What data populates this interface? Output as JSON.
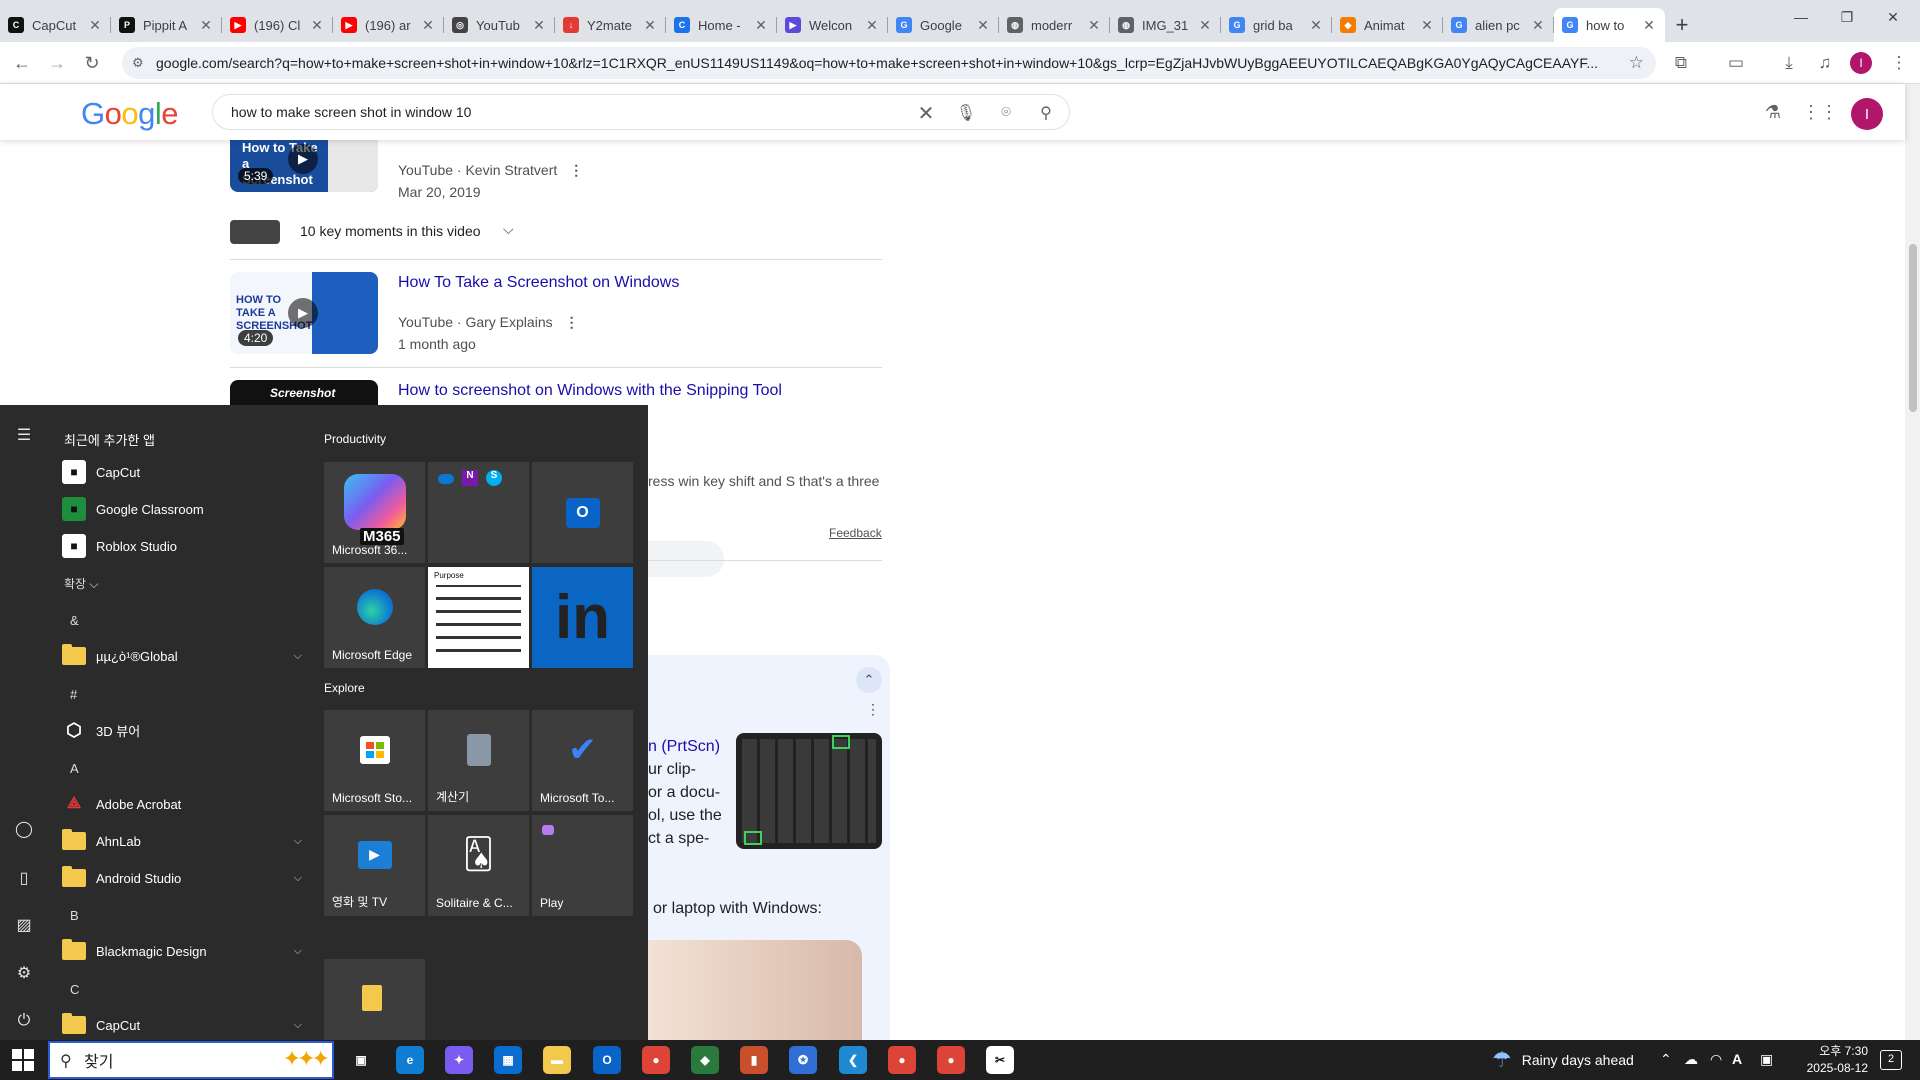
{
  "browser": {
    "tabs": [
      {
        "label": "CapCut",
        "color": "#111111",
        "glyph": "C"
      },
      {
        "label": "Pippit A",
        "color": "#111111",
        "glyph": "P"
      },
      {
        "label": "(196) Cl",
        "color": "#ff0000",
        "glyph": "▶"
      },
      {
        "label": "(196) ar",
        "color": "#ff0000",
        "glyph": "▶"
      },
      {
        "label": "YouTub",
        "color": "#444444",
        "glyph": "◎"
      },
      {
        "label": "Y2mate",
        "color": "#e53935",
        "glyph": "↓"
      },
      {
        "label": "Home -",
        "color": "#1a73e8",
        "glyph": "C"
      },
      {
        "label": "Welcon",
        "color": "#5c4bdb",
        "glyph": "▶"
      },
      {
        "label": "Google",
        "color": "#4285f4",
        "glyph": "G"
      },
      {
        "label": "moderr",
        "color": "#5f6368",
        "glyph": "◍"
      },
      {
        "label": "IMG_31",
        "color": "#5f6368",
        "glyph": "◍"
      },
      {
        "label": "grid ba",
        "color": "#4285f4",
        "glyph": "G"
      },
      {
        "label": "Animat",
        "color": "#f57c00",
        "glyph": "◆"
      },
      {
        "label": "alien pc",
        "color": "#4285f4",
        "glyph": "G"
      },
      {
        "label": "how to",
        "color": "#4285f4",
        "glyph": "G"
      }
    ],
    "url": "google.com/search?q=how+to+make+screen+shot+in+window+10&rlz=1C1RXQR_enUS1149US1149&oq=how+to+make+screen+shot+in+window+10&gs_lcrp=EgZjaHJvbWUyBggAEEUYOTILCAEQABgKGA0YgAQyCAgCEAAYF...",
    "profile_initial": "I"
  },
  "google": {
    "logo": [
      "G",
      "o",
      "o",
      "g",
      "l",
      "e"
    ],
    "query": "how to make screen shot in window 10",
    "profile_initial": "I"
  },
  "results": {
    "video1": {
      "thumb_text": "How to Take a Screenshot",
      "duration": "5:39",
      "source": "YouTube · Kevin Stratvert",
      "date": "Mar 20, 2019"
    },
    "key_moments": "10 key moments in this video",
    "video2": {
      "title": "How To Take a Screenshot on Windows",
      "thumb_text": "HOW TO TAKE A SCREENSHOT",
      "duration": "4:20",
      "source": "YouTube · Gary Explains",
      "date": "1 month ago"
    },
    "video3": {
      "title": "How to screenshot on Windows with the Snipping Tool",
      "thumb_text": "Screenshot"
    },
    "snippet_tail": "ress win key shift and S that's a three",
    "feedback": "Feedback",
    "answer_lines": [
      "n (PrtScn)",
      "ur clip-",
      "or a docu-",
      "ol, use the",
      "ct a spe-"
    ],
    "answer_footer": "or laptop with Windows:"
  },
  "startmenu": {
    "recent_header": "최근에 추가한 앱",
    "recent_apps": [
      {
        "label": "CapCut",
        "icon": "capcut-icon",
        "color": "#ffffff"
      },
      {
        "label": "Google Classroom",
        "icon": "classroom-icon",
        "color": "#1e8e3e"
      },
      {
        "label": "Roblox Studio",
        "icon": "roblox-icon",
        "color": "#ffffff"
      }
    ],
    "expand_label": "확장 ⌵",
    "letters": {
      "amp": "&",
      "hash": "#",
      "a": "A",
      "b": "B",
      "c": "C"
    },
    "apps": {
      "global": "µµ¿ò¹®Global",
      "viewer3d": "3D 뷰어",
      "acrobat": "Adobe Acrobat",
      "ahnlab": "AhnLab",
      "android": "Android Studio",
      "blackmagic": "Blackmagic Design",
      "capcut": "CapCut"
    },
    "groups": {
      "productivity": "Productivity",
      "explore": "Explore"
    },
    "tiles": {
      "m365": "Microsoft 36...",
      "m365_badge": "M365",
      "edge": "Microsoft Edge",
      "store": "Microsoft Sto...",
      "calc": "계산기",
      "todo": "Microsoft To...",
      "movies": "영화 및 TV",
      "solitaire": "Solitaire & C...",
      "play": "Play",
      "purpose_title": "Purpose"
    }
  },
  "taskbar": {
    "search_text": "찾기",
    "weather": "Rainy days ahead",
    "time": "오후 7:30",
    "date": "2025-08-12",
    "notif_count": "2",
    "apps": [
      {
        "name": "task-view-icon",
        "color": "#1f1f1f",
        "glyph": "▣"
      },
      {
        "name": "edge-icon",
        "color": "#0f7dd1",
        "glyph": "e"
      },
      {
        "name": "copilot-icon",
        "color": "#7b5cf0",
        "glyph": "✦"
      },
      {
        "name": "store-icon",
        "color": "#0a6cd1",
        "glyph": "▦"
      },
      {
        "name": "file-explorer-icon",
        "color": "#f2c94c",
        "glyph": "▬"
      },
      {
        "name": "outlook-icon",
        "color": "#0a64c8",
        "glyph": "O"
      },
      {
        "name": "chrome-icon",
        "color": "#db4437",
        "glyph": "●"
      },
      {
        "name": "git-icon",
        "color": "#2b7a3d",
        "glyph": "◆"
      },
      {
        "name": "paint-icon",
        "color": "#c94f2a",
        "glyph": "▮"
      },
      {
        "name": "app-icon",
        "color": "#2f6fd6",
        "glyph": "✪"
      },
      {
        "name": "vscode-icon",
        "color": "#1f8ad2",
        "glyph": "❮"
      },
      {
        "name": "chrome-profile-icon",
        "color": "#db4437",
        "glyph": "●"
      },
      {
        "name": "chrome-profile2-icon",
        "color": "#db4437",
        "glyph": "●"
      },
      {
        "name": "capcut-taskbar-icon",
        "color": "#ffffff",
        "glyph": "✂"
      }
    ]
  }
}
